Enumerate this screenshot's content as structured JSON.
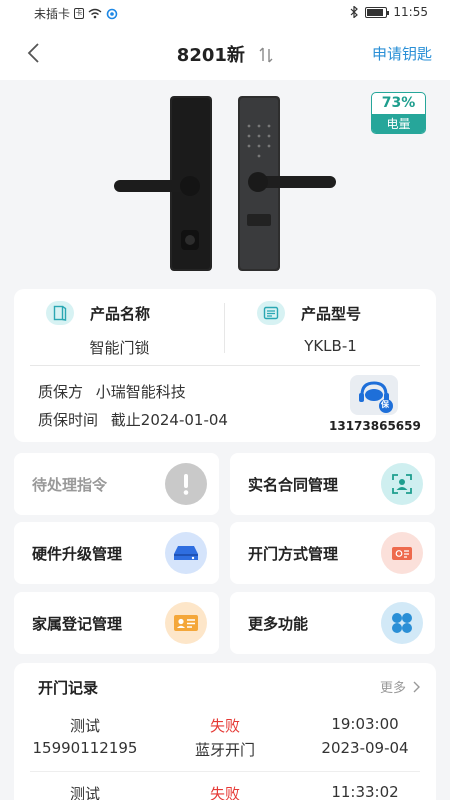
{
  "status_bar": {
    "carrier": "未插卡",
    "time": "11:55"
  },
  "nav": {
    "title": "8201新",
    "right_action": "申请钥匙"
  },
  "device": {
    "battery_percent": "73%",
    "battery_label": "电量"
  },
  "product": {
    "name_label": "产品名称",
    "name_value": "智能门锁",
    "model_label": "产品型号",
    "model_value": "YKLB-1",
    "warranty_party_label": "质保方",
    "warranty_party_value": "小瑞智能科技",
    "warranty_time_label": "质保时间",
    "warranty_time_value": "截止2024-01-04",
    "service_phone": "13173865659",
    "service_badge": "保"
  },
  "functions": {
    "pending": "待处理指令",
    "realname": "实名合同管理",
    "firmware": "硬件升级管理",
    "unlock_methods": "开门方式管理",
    "family": "家属登记管理",
    "more": "更多功能"
  },
  "records": {
    "title": "开门记录",
    "more_label": "更多",
    "rows": [
      {
        "name": "测试",
        "phone": "15990112195",
        "status": "失败",
        "method": "蓝牙开门",
        "time": "19:03:00",
        "date": "2023-09-04"
      },
      {
        "name": "测试",
        "status": "失败",
        "time": "11:33:02"
      }
    ]
  },
  "colors": {
    "accent": "#2a8fd6",
    "teal": "#26a69a",
    "fail": "#e53935"
  }
}
